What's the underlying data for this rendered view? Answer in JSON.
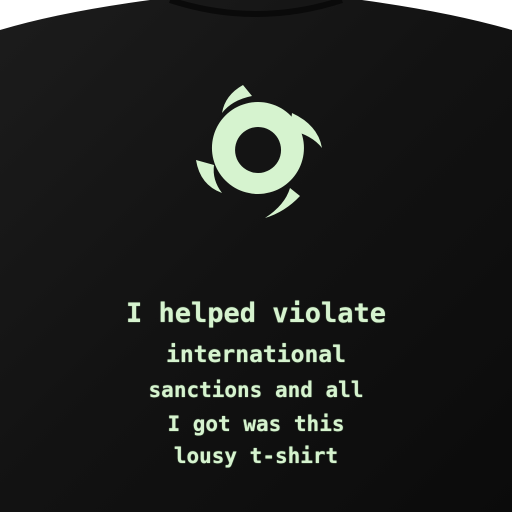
{
  "shirt": {
    "color": "#151515",
    "print_color": "#d6f3cf",
    "logo": "hurricane-icon",
    "slogan_lines": [
      "I helped violate",
      "international",
      "sanctions and all",
      "I got was this",
      "lousy t-shirt"
    ]
  }
}
